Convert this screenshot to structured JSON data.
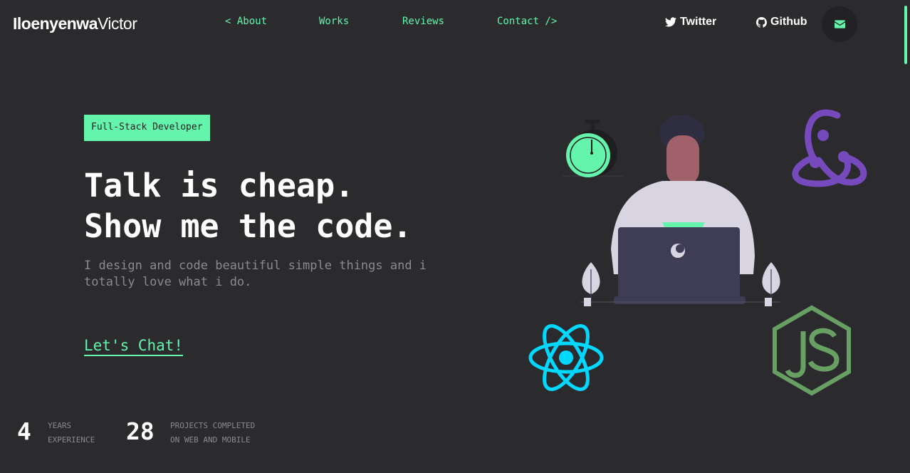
{
  "logo": {
    "first": "Iloenyenwa",
    "last": "Victor"
  },
  "nav": {
    "about": "< About",
    "works": "Works",
    "reviews": "Reviews",
    "contact": "Contact />"
  },
  "social": {
    "twitter": "Twitter",
    "github": "Github",
    "mail_icon": "envelope-icon"
  },
  "hero": {
    "badge": "Full-Stack Developer",
    "headline_line1": "Talk is cheap.",
    "headline_line2": "Show me the code.",
    "subtitle": "I design and code beautiful simple things and i totally love what i do.",
    "cta": "Let's Chat!"
  },
  "stats": [
    {
      "value": "4",
      "label_line1": "YEARS",
      "label_line2": "EXPERIENCE"
    },
    {
      "value": "28",
      "label_line1": "PROJECTS COMPLETED",
      "label_line2": "ON WEB AND MOBILE"
    }
  ],
  "colors": {
    "background": "#2b2b2e",
    "accent": "#64f4ac",
    "react": "#00d8ff",
    "redux": "#764abc",
    "node": "#68a063"
  }
}
